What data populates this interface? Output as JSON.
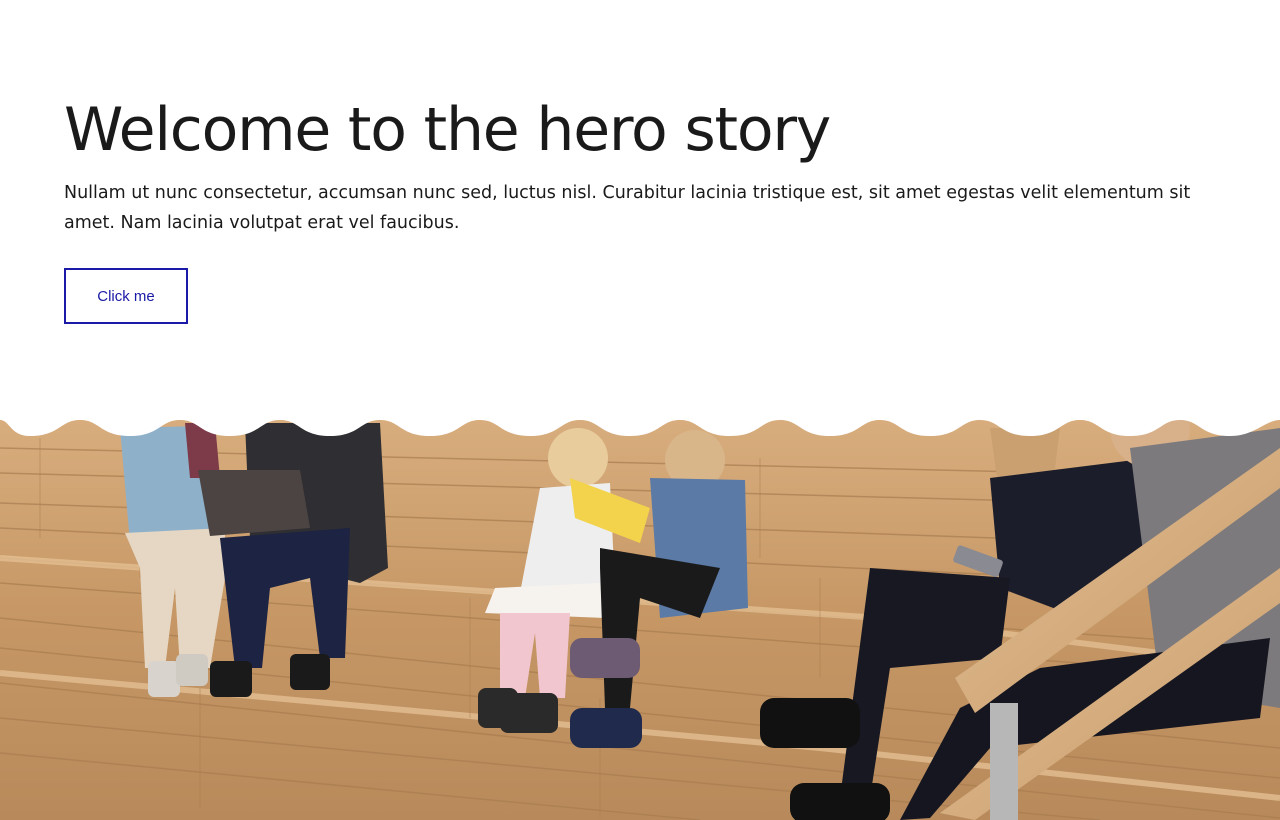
{
  "hero": {
    "title": "Welcome to the hero story",
    "body": "Nullam ut nunc consectetur, accumsan nunc sed, luctus nisl. Curabitur lacinia tristique est, sit amet egestas velit elementum sit amet. Nam lacinia volutpat erat vel faucibus.",
    "button_label": "Click me"
  },
  "colors": {
    "accent": "#1a1aa6",
    "text": "#1a1a1a",
    "background": "#ffffff",
    "wood": "#c99b6a"
  },
  "image": {
    "description_icon": "photo-people-on-wooden-bleachers"
  }
}
